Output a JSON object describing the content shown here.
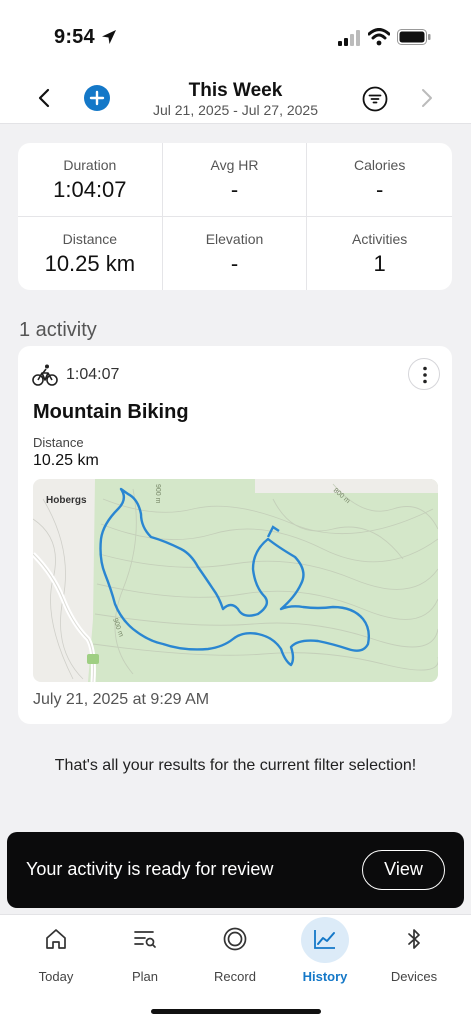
{
  "status_bar": {
    "time": "9:54"
  },
  "header": {
    "title": "This Week",
    "date_range": "Jul 21, 2025 - Jul 27, 2025"
  },
  "stats": [
    {
      "label": "Duration",
      "value": "1:04:07"
    },
    {
      "label": "Avg HR",
      "value": "-"
    },
    {
      "label": "Calories",
      "value": "-"
    },
    {
      "label": "Distance",
      "value": "10.25 km"
    },
    {
      "label": "Elevation",
      "value": "-"
    },
    {
      "label": "Activities",
      "value": "1"
    }
  ],
  "section_title": "1 activity",
  "activity": {
    "duration": "1:04:07",
    "title": "Mountain Biking",
    "distance_label": "Distance",
    "distance_value": "10.25 km",
    "date": "July 21, 2025 at 9:29 AM",
    "map": {
      "place_label": "Hobergs",
      "contour_label_1": "800 m",
      "contour_label_2": "900 m",
      "contour_label_3": "900 m"
    }
  },
  "end_message": "That's all your results for the current filter selection!",
  "toast": {
    "text": "Your activity is ready for review",
    "button": "View"
  },
  "tabs": [
    {
      "label": "Today",
      "icon": "home-icon"
    },
    {
      "label": "Plan",
      "icon": "plan-list-icon"
    },
    {
      "label": "Record",
      "icon": "record-icon"
    },
    {
      "label": "History",
      "icon": "chart-trend-icon",
      "active": true
    },
    {
      "label": "Devices",
      "icon": "bluetooth-icon"
    }
  ],
  "colors": {
    "accent": "#1478c8",
    "route": "#2a86d1",
    "map_green": "#d4e7c9"
  }
}
